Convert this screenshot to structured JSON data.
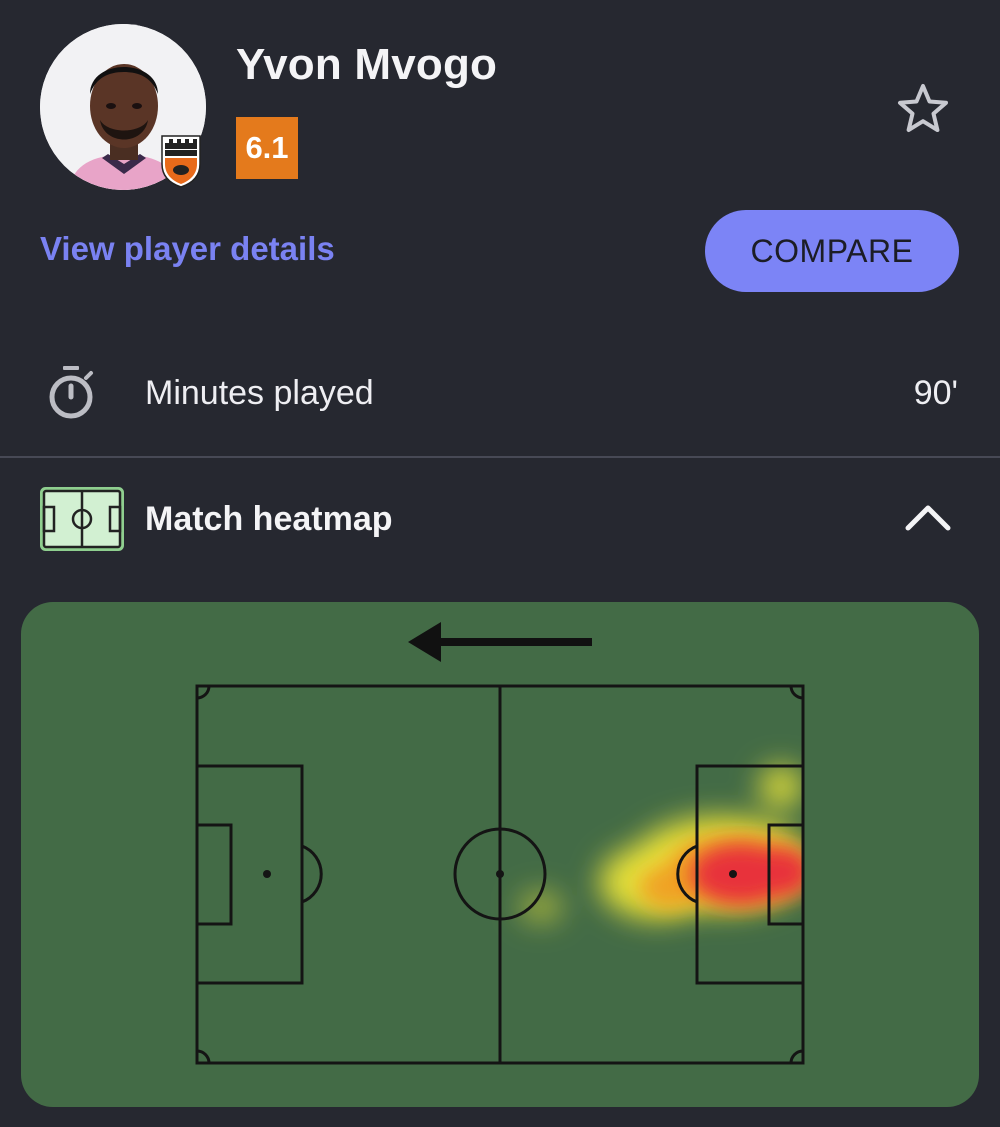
{
  "player": {
    "name": "Yvon Mvogo",
    "rating": "6.1",
    "rating_color": "#e47a1c",
    "club_badge_text": "FC LORIENT",
    "view_details_label": "View player details",
    "compare_label": "COMPARE",
    "favorite_icon": "star-outline-icon"
  },
  "stats": [
    {
      "icon": "stopwatch-icon",
      "label": "Minutes played",
      "value": "90'"
    }
  ],
  "heatmap": {
    "title": "Match heatmap",
    "icon": "pitch-icon",
    "expanded": true,
    "attack_direction": "left",
    "colors": {
      "pitch": "#436b46",
      "accent": "#7c84f6",
      "hot": "#e8303a",
      "warm": "#f4a21e",
      "cool": "#e9e43a"
    }
  }
}
